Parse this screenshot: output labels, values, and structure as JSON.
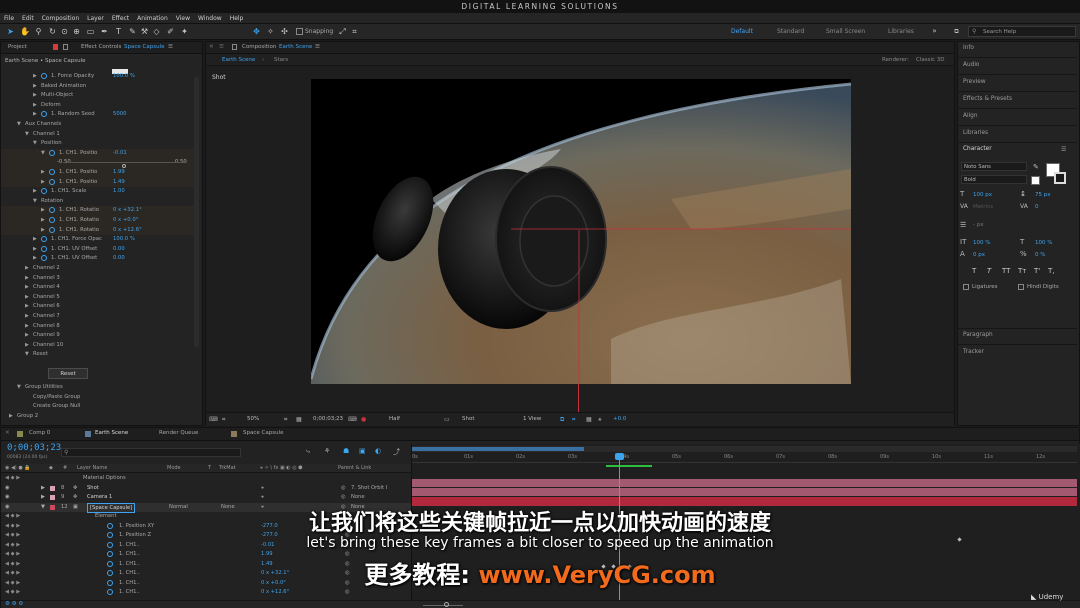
{
  "title_bar": "DIGITAL LEARNING SOLUTIONS",
  "menu": [
    "File",
    "Edit",
    "Composition",
    "Layer",
    "Effect",
    "Animation",
    "View",
    "Window",
    "Help"
  ],
  "toolbar": {
    "snapping": "Snapping",
    "workspaces": [
      "Default",
      "Standard",
      "Small Screen",
      "Libraries"
    ],
    "active_workspace": "Default",
    "search_placeholder": "Search Help"
  },
  "left_panel": {
    "tab_project": "Project",
    "tab_effect_controls": "Effect Controls",
    "effect_target": "Space Capsule",
    "breadcrumb": "Earth Scene • Space Capsule",
    "rows": [
      {
        "indent": 4,
        "twirl": "▶",
        "sw": true,
        "label": "1. Force Opacity",
        "value": "100.0 %"
      },
      {
        "indent": 4,
        "twirl": "▶",
        "label": "Baked Animation"
      },
      {
        "indent": 4,
        "twirl": "▶",
        "label": "Multi-Object"
      },
      {
        "indent": 4,
        "twirl": "▶",
        "label": "Deform"
      },
      {
        "indent": 4,
        "twirl": "▶",
        "sw": true,
        "label": "1. Random Seed",
        "value": "5000"
      },
      {
        "indent": 2,
        "twirl": "▼",
        "label": "Aux Channels"
      },
      {
        "indent": 3,
        "twirl": "▼",
        "label": "Channel 1"
      },
      {
        "indent": 4,
        "twirl": "▼",
        "label": "Position"
      },
      {
        "indent": 5,
        "twirl": "▼",
        "sw": true,
        "label": "1. CH1. Positio",
        "value": "-0.01",
        "hl": true
      },
      {
        "indent": 6,
        "label": "-0.50",
        "value2": "0.50",
        "slider": true,
        "hl": true
      },
      {
        "indent": 5,
        "twirl": "▶",
        "sw": true,
        "label": "1. CH1. Positio",
        "value": "1.99",
        "hl": true
      },
      {
        "indent": 5,
        "twirl": "▶",
        "sw": true,
        "label": "1. CH1. Positio",
        "value": "1.49",
        "hl": true
      },
      {
        "indent": 4,
        "twirl": "▶",
        "sw": true,
        "label": "1. CH1. Scale",
        "value": "1.00"
      },
      {
        "indent": 4,
        "twirl": "▼",
        "label": "Rotation"
      },
      {
        "indent": 5,
        "twirl": "▶",
        "sw": true,
        "label": "1. CH1. Rotatio",
        "value": "0 x +32.1°",
        "hl": true
      },
      {
        "indent": 5,
        "twirl": "▶",
        "sw": true,
        "label": "1. CH1. Rotatio",
        "value": "0 x +0.0°",
        "hl": true
      },
      {
        "indent": 5,
        "twirl": "▶",
        "sw": true,
        "label": "1. CH1. Rotatio",
        "value": "0 x +12.6°",
        "hl": true
      },
      {
        "indent": 4,
        "twirl": "▶",
        "sw": true,
        "label": "1. CH1. Force Opac",
        "value": "100.0 %"
      },
      {
        "indent": 4,
        "twirl": "▶",
        "sw": true,
        "label": "1. CH1. UV Offset",
        "value": "0.00"
      },
      {
        "indent": 4,
        "twirl": "▶",
        "sw": true,
        "label": "1. CH1. UV Offset",
        "value": "0.00"
      },
      {
        "indent": 3,
        "twirl": "▶",
        "label": "Channel 2"
      },
      {
        "indent": 3,
        "twirl": "▶",
        "label": "Channel 3"
      },
      {
        "indent": 3,
        "twirl": "▶",
        "label": "Channel 4"
      },
      {
        "indent": 3,
        "twirl": "▶",
        "label": "Channel 5"
      },
      {
        "indent": 3,
        "twirl": "▶",
        "label": "Channel 6"
      },
      {
        "indent": 3,
        "twirl": "▶",
        "label": "Channel 7"
      },
      {
        "indent": 3,
        "twirl": "▶",
        "label": "Channel 8"
      },
      {
        "indent": 3,
        "twirl": "▶",
        "label": "Channel 9"
      },
      {
        "indent": 3,
        "twirl": "▶",
        "label": "Channel 10"
      },
      {
        "indent": 3,
        "twirl": "▼",
        "label": "Reset"
      }
    ],
    "reset_button": "Reset",
    "rows2": [
      {
        "indent": 2,
        "twirl": "▼",
        "label": "Group Utilities"
      },
      {
        "indent": 3,
        "label": "Copy/Paste Group"
      },
      {
        "indent": 3,
        "label": "Create Group Null"
      },
      {
        "indent": 1,
        "twirl": "▶",
        "label": "Group 2"
      }
    ]
  },
  "composition": {
    "tab_label": "Composition",
    "tab_name": "Earth Scene",
    "flow": [
      "Earth Scene",
      "Stars"
    ],
    "renderer_label": "Renderer:",
    "renderer_value": "Classic 3D",
    "camera_label": "Shot",
    "footer": {
      "zoom": "50%",
      "timecode": "0;00;03;23",
      "resolution": "Half",
      "camera": "Shot",
      "views": "1 View",
      "exposure": "+0.0"
    }
  },
  "right_panel": {
    "search_placeholder": "Search Help",
    "items": [
      "Info",
      "Audio",
      "Preview",
      "Effects & Presets",
      "Align",
      "Libraries"
    ],
    "character_title": "Character",
    "font_family": "Noto Sans",
    "font_style": "Bold",
    "font_size": "100 px",
    "leading": "75 px",
    "kerning": "Metrics",
    "tracking": "0",
    "stroke_unit": "- px",
    "vscale": "100 %",
    "hscale": "100 %",
    "baseline": "0 px",
    "tsume": "0 %",
    "text_styles": [
      "T",
      "T",
      "TT",
      "Tт",
      "T'",
      "T,"
    ],
    "ligatures": "Ligatures",
    "hindi_digits": "Hindi Digits",
    "paragraph": "Paragraph",
    "tracker": "Tracker"
  },
  "timeline": {
    "tabs": [
      "Comp 0",
      "Earth Scene",
      "Render Queue",
      "Space Capsule"
    ],
    "active_tab": "Earth Scene",
    "timecode": "0;00;03;23",
    "timecode_sub": "00083 (24.00 fps)",
    "headers": [
      "Layer Name",
      "Mode",
      "T",
      "TrkMat",
      "Parent & Link"
    ],
    "ruler": [
      "0s",
      "01s",
      "02s",
      "03s",
      "04s",
      "05s",
      "06s",
      "07s",
      "08s",
      "09s",
      "10s",
      "11s",
      "12s"
    ],
    "layers": [
      {
        "label": "Material Options",
        "indent": 2
      },
      {
        "num": "8",
        "name": "Shot",
        "parent": "7. Shot Orbit I",
        "color": "#d9a1b6"
      },
      {
        "num": "9",
        "name": "Camera 1",
        "parent": "None",
        "color": "#d9a1b6"
      },
      {
        "num": "12",
        "name": "[Space Capsule]",
        "mode": "Normal",
        "trkmat": "None",
        "parent": "None",
        "color": "#c94b5c",
        "selected": true
      },
      {
        "label": "Element",
        "indent": 3
      },
      {
        "label": "1. Position XY",
        "indent": 5,
        "value": "-277.0"
      },
      {
        "label": "1. Position Z",
        "indent": 5,
        "value": "-277.0"
      },
      {
        "label": "1. CH1..",
        "indent": 5,
        "value": "-0.01"
      },
      {
        "label": "1. CH1..",
        "indent": 5,
        "value": "1.99"
      },
      {
        "label": "1. CH1..",
        "indent": 5,
        "value": "1.49"
      },
      {
        "label": "1. CH1..",
        "indent": 5,
        "value": "0 x +32.1°"
      },
      {
        "label": "1. CH1..",
        "indent": 5,
        "value": "0 x +0.0°"
      },
      {
        "label": "1. CH1..",
        "indent": 5,
        "value": "0 x +12.6°"
      }
    ]
  },
  "subtitles": {
    "chinese": "让我们将这些关键帧拉近一点以加快动画的速度",
    "english": "let's bring these key frames a bit closer to speed up the animation",
    "promo_label": "更多教程:",
    "promo_url": "www.VeryCG.com"
  },
  "watermark": "Udemy"
}
